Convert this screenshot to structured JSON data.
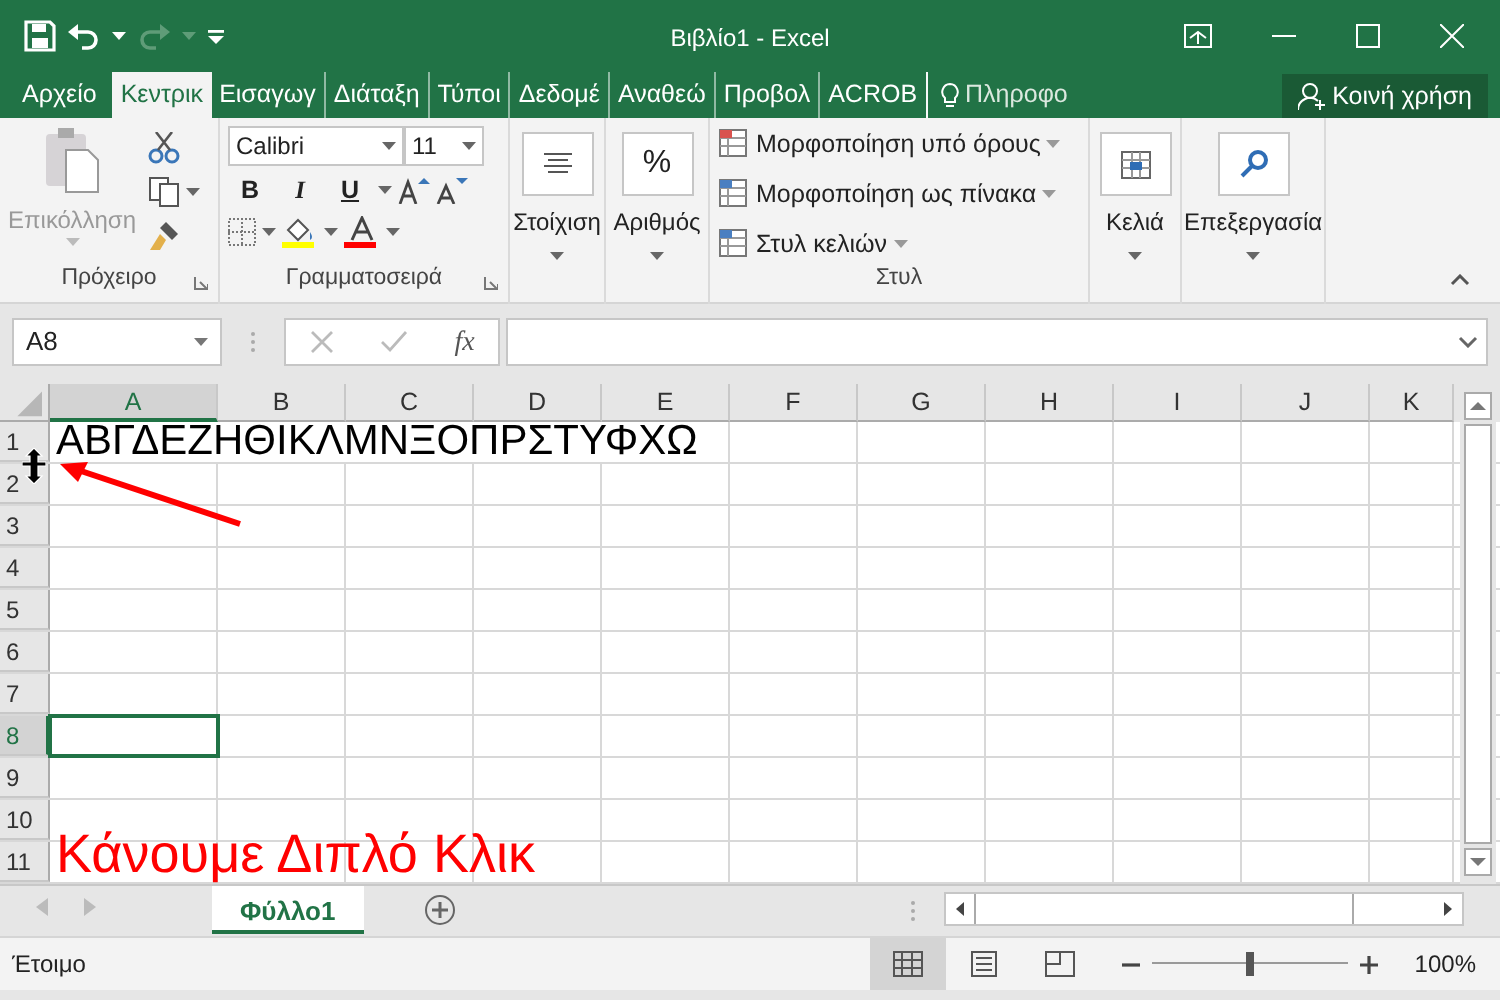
{
  "window": {
    "title": "Βιβλίο1 - Excel"
  },
  "tabs": [
    {
      "label": "Αρχείο",
      "selected": false
    },
    {
      "label": "Κεντρικ",
      "selected": true
    },
    {
      "label": "Εισαγωγ",
      "selected": false
    },
    {
      "label": "Διάταξη",
      "selected": false
    },
    {
      "label": "Τύποι",
      "selected": false
    },
    {
      "label": "Δεδομέ",
      "selected": false
    },
    {
      "label": "Αναθεώ",
      "selected": false
    },
    {
      "label": "Προβολ",
      "selected": false
    },
    {
      "label": "ACROB",
      "selected": false
    }
  ],
  "tell_me": {
    "label": "Πληροφο"
  },
  "share_button": {
    "label": "Κοινή χρήση"
  },
  "ribbon": {
    "groups": [
      {
        "kind": "clipboard",
        "label": "Πρόχειρο",
        "paste_label": "Επικόλληση",
        "paste_disabled": true
      },
      {
        "kind": "font",
        "label": "Γραμματοσειρά",
        "font": "Calibri",
        "size": "11",
        "bold": "B",
        "italic": "I",
        "underline": "U"
      },
      {
        "kind": "alignment",
        "button": "Στοίχιση"
      },
      {
        "kind": "number",
        "button": "Αριθμός",
        "symbol": "%"
      },
      {
        "kind": "styles",
        "label": "Στυλ",
        "items": [
          "Μορφοποίηση υπό όρους",
          "Μορφοποίηση ως πίνακα",
          "Στυλ κελιών"
        ]
      },
      {
        "kind": "cells",
        "button": "Κελιά"
      },
      {
        "kind": "editing",
        "button": "Επεξεργασία"
      }
    ]
  },
  "formula_bar": {
    "name_box": "A8",
    "function_symbol": "fx"
  },
  "sheet": {
    "columns": [
      {
        "label": "A",
        "selected": true
      },
      {
        "label": "B",
        "selected": false
      },
      {
        "label": "C",
        "selected": false
      },
      {
        "label": "D",
        "selected": false
      },
      {
        "label": "E",
        "selected": false
      },
      {
        "label": "F",
        "selected": false
      },
      {
        "label": "G",
        "selected": false
      },
      {
        "label": "H",
        "selected": false
      },
      {
        "label": "I",
        "selected": false
      },
      {
        "label": "J",
        "selected": false
      },
      {
        "label": "K",
        "selected": false
      }
    ],
    "rows": [
      {
        "label": "1",
        "selected": false,
        "text": "ΑΒΓΔΕΖΗΘΙΚΛΜΝΞΟΠΡΣΤΥΦΧΩ",
        "kind": "letters",
        "color": "#000000"
      },
      {
        "label": "2",
        "selected": false
      },
      {
        "label": "3",
        "selected": false
      },
      {
        "label": "4",
        "selected": false
      },
      {
        "label": "5",
        "selected": false
      },
      {
        "label": "6",
        "selected": false
      },
      {
        "label": "7",
        "selected": false
      },
      {
        "label": "8",
        "selected": true
      },
      {
        "label": "9",
        "selected": false
      },
      {
        "label": "10",
        "selected": false
      },
      {
        "label": "11",
        "selected": false,
        "text": "Κάνουμε Διπλό Κλικ",
        "kind": "note",
        "color": "#ff0000"
      }
    ]
  },
  "sheet_tabs": [
    {
      "label": "Φύλλο1",
      "selected": true
    }
  ],
  "status_bar": {
    "text": "Έτοιμο",
    "views": [
      {
        "kind": "normal",
        "selected": true
      },
      {
        "kind": "page_layout",
        "selected": false
      },
      {
        "kind": "page_break",
        "selected": false
      }
    ],
    "zoom": {
      "level": 0.5,
      "reading": "100%"
    }
  }
}
